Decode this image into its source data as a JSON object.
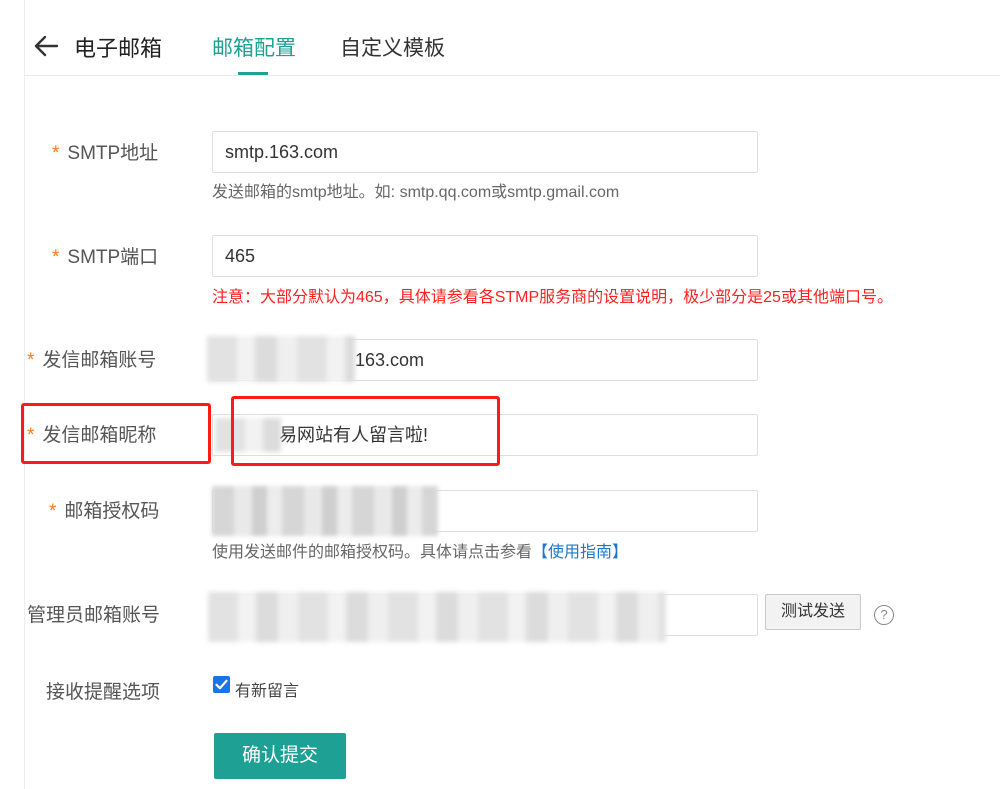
{
  "header": {
    "title": "电子邮箱",
    "tabs": [
      {
        "label": "邮箱配置",
        "active": true
      },
      {
        "label": "自定义模板",
        "active": false
      }
    ]
  },
  "form": {
    "required_mark": "*",
    "smtp_host": {
      "label": "SMTP地址",
      "value": "smtp.163.com",
      "hint": "发送邮箱的smtp地址。如: smtp.qq.com或smtp.gmail.com"
    },
    "smtp_port": {
      "label": "SMTP端口",
      "value": "465",
      "warning": "注意：大部分默认为465，具体请参看各STMP服务商的设置说明，极少部分是25或其他端口号。"
    },
    "sender_account": {
      "label": "发信邮箱账号",
      "visible_value": "163.com"
    },
    "sender_nickname": {
      "label": "发信邮箱昵称",
      "visible_value": "易网站有人留言啦!"
    },
    "auth_code": {
      "label": "邮箱授权码",
      "hint_prefix": "使用发送邮件的邮箱授权码。具体请点击参看",
      "hint_link": "【使用指南】"
    },
    "admin_account": {
      "label": "管理员邮箱账号",
      "test_button": "测试发送",
      "help_glyph": "?"
    },
    "notify": {
      "label": "接收提醒选项",
      "checkbox_label": "有新留言",
      "checked": true
    },
    "submit_label": "确认提交"
  },
  "colors": {
    "accent": "#1ea094",
    "required": "#ff7a1a",
    "warning": "#ff2020",
    "annotation": "#ff1a1a",
    "checkbox": "#1a73e8"
  }
}
